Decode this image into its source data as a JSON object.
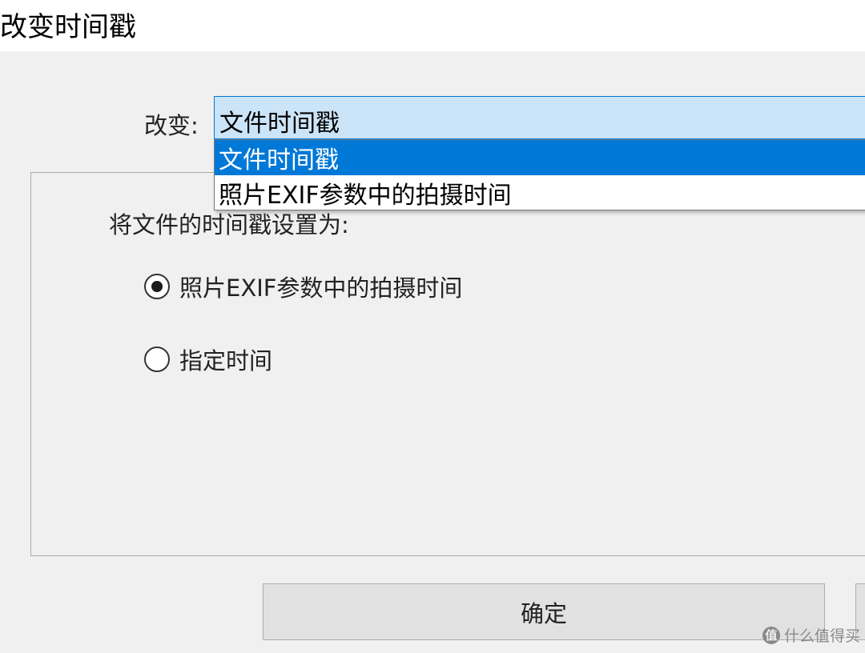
{
  "window": {
    "title": "改变时间戳"
  },
  "change": {
    "label": "改变:",
    "selected_value": "文件时间戳",
    "options": [
      "文件时间戳",
      "照片EXIF参数中的拍摄时间"
    ]
  },
  "group": {
    "title": "将文件的时间戳设置为:",
    "radios": [
      {
        "label": "照片EXIF参数中的拍摄时间",
        "checked": true
      },
      {
        "label": "指定时间",
        "checked": false
      }
    ]
  },
  "buttons": {
    "ok_label": "确定"
  },
  "watermark": {
    "icon_glyph": "值",
    "text": "什么值得买"
  },
  "colors": {
    "accent": "#0078d7",
    "combo_fill": "#cce4f7",
    "dialog_bg": "#f0f0f0"
  }
}
